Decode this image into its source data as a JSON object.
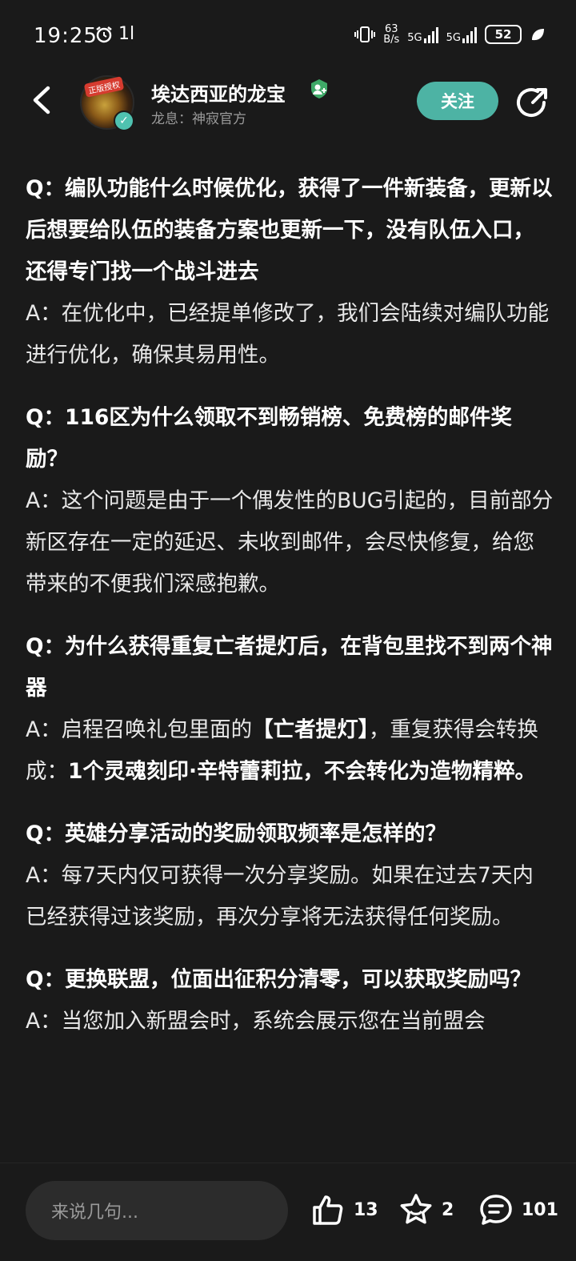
{
  "status": {
    "time": "19:25",
    "net_speed_top": "63",
    "net_speed_bottom": "B/s",
    "net1": "5G",
    "net2": "5G",
    "battery": "52",
    "left_extra": "1l"
  },
  "header": {
    "author_name": "埃达西亚的龙宝",
    "author_sub": "龙息：神寂官方",
    "avatar_tag": "正版授权",
    "follow_label": "关注"
  },
  "qa": [
    {
      "q": "Q：编队功能什么时候优化，获得了一件新装备，更新以后想要给队伍的装备方案也更新一下，没有队伍入口，还得专门找一个战斗进去",
      "a": "A：在优化中，已经提单修改了，我们会陆续对编队功能进行优化，确保其易用性。"
    },
    {
      "q": "Q：116区为什么领取不到畅销榜、免费榜的邮件奖励？",
      "a": "A：这个问题是由于一个偶发性的BUG引起的，目前部分新区存在一定的延迟、未收到邮件，会尽快修复，给您带来的不便我们深感抱歉。"
    },
    {
      "q": "Q：为什么获得重复亡者提灯后，在背包里找不到两个神器",
      "a_part1": "A：启程召唤礼包里面的",
      "a_bold1": "【亡者提灯】",
      "a_part2": "，重复获得会转换成：",
      "a_bold2": "1个灵魂刻印·辛特蕾莉拉，不会转化为造物精粹。"
    },
    {
      "q": "Q：英雄分享活动的奖励领取频率是怎样的？",
      "a": "A：每7天内仅可获得一次分享奖励。如果在过去7天内已经获得过该奖励，再次分享将无法获得任何奖励。"
    },
    {
      "q": "Q：更换联盟，位面出征积分清零，可以获取奖励吗？",
      "a": "A：当您加入新盟会时，系统会展示您在当前盟会"
    }
  ],
  "bottom": {
    "comment_placeholder": "来说几句...",
    "likes": "13",
    "favorites": "2",
    "comments": "101"
  },
  "colors": {
    "background": "#1a1a1a",
    "accent": "#4db3a4",
    "muted_text": "#9a9a9a"
  }
}
